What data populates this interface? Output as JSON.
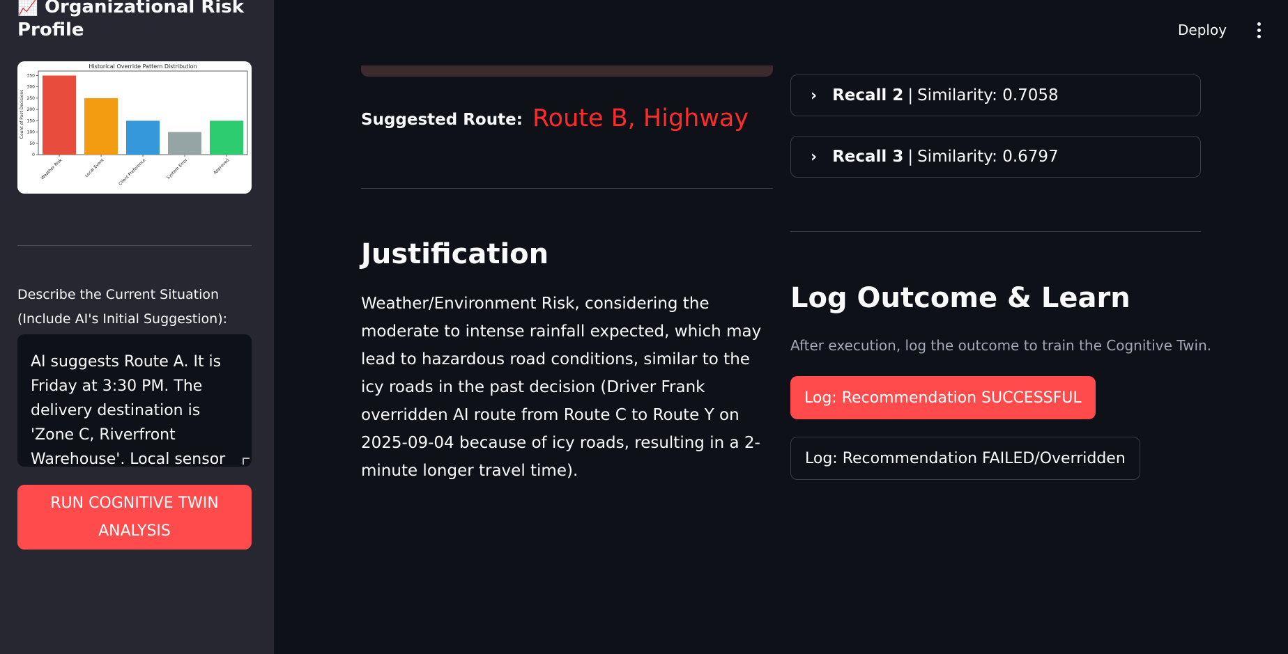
{
  "sidebar": {
    "title_icon": "📈",
    "title": "Organizational Risk Profile",
    "situation_label": "Describe the Current Situation (Include AI's Initial Suggestion):",
    "situation_text": "AI suggests Route A. It is Friday at 3:30 PM. The delivery destination is 'Zone C, Riverfront Warehouse'. Local sensor",
    "run_button": "RUN COGNITIVE TWIN ANALYSIS"
  },
  "header": {
    "deploy": "Deploy",
    "menu_icon": "vertical-ellipsis-icon"
  },
  "main": {
    "suggested_label": "Suggested Route:",
    "suggested_route": "Route B, Highway",
    "justification_title": "Justification",
    "justification_text": "Weather/Environment Risk, considering the moderate to intense rainfall expected, which may lead to hazardous road conditions, similar to the icy roads in the past decision (Driver Frank overridden AI route from Route C to Route Y on 2025-09-04 because of icy roads, resulting in a 2-minute longer travel time).",
    "recalls": [
      {
        "label": "Recall 2",
        "sep": "|",
        "similarity": "Similarity: 0.7058"
      },
      {
        "label": "Recall 3",
        "sep": "|",
        "similarity": "Similarity: 0.6797"
      }
    ],
    "log_title": "Log Outcome & Learn",
    "log_subtitle": "After execution, log the outcome to train the Cognitive Twin.",
    "log_success": "Log: Recommendation SUCCESSFUL",
    "log_failed": "Log: Recommendation FAILED/Overridden"
  },
  "colors": {
    "accent": "#ff4b4b",
    "route": "#ff2b2b",
    "sidebar_bg": "#262730",
    "main_bg": "#0e1117"
  },
  "chart_data": {
    "type": "bar",
    "title": "Historical Override Pattern Distribution",
    "ylabel": "Count of Past Decisions",
    "xlabel": "",
    "categories": [
      "Weather Risk",
      "Local Event",
      "Client Preference",
      "System Error",
      "Approved"
    ],
    "values": [
      350,
      250,
      150,
      100,
      150
    ],
    "colors": [
      "#e74c3c",
      "#f39c12",
      "#3498db",
      "#95a5a6",
      "#2ecc71"
    ],
    "ylim": [
      0,
      370
    ],
    "yticks": [
      0,
      50,
      100,
      150,
      200,
      250,
      300,
      350
    ],
    "grid": false
  }
}
